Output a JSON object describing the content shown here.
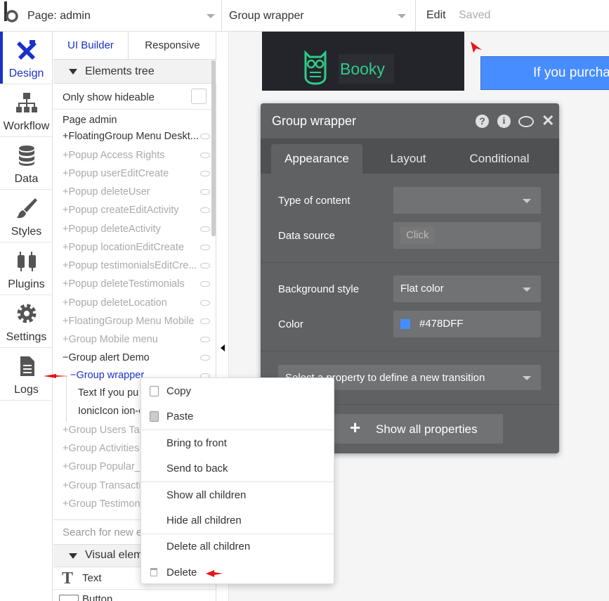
{
  "topbar": {
    "page_select": "Page: admin",
    "element_select": "Group wrapper",
    "edit_label": "Edit",
    "saved_label": "Saved"
  },
  "nav": {
    "items": [
      {
        "label": "Design",
        "icon": "design-icon"
      },
      {
        "label": "Workflow",
        "icon": "workflow-icon"
      },
      {
        "label": "Data",
        "icon": "database-icon"
      },
      {
        "label": "Styles",
        "icon": "brush-icon"
      },
      {
        "label": "Plugins",
        "icon": "plug-icon"
      },
      {
        "label": "Settings",
        "icon": "gear-icon"
      },
      {
        "label": "Logs",
        "icon": "document-icon"
      }
    ]
  },
  "panel": {
    "tabs": [
      "UI Builder",
      "Responsive"
    ],
    "elements_tree_label": "Elements tree",
    "only_hideable_label": "Only show hideable",
    "tree": [
      "Page admin",
      "FloatingGroup Menu Deskt...",
      "Popup Access Rights",
      "Popup userEditCreate",
      "Popup deleteUser",
      "Popup createEditActivity",
      "Popup deleteActivity",
      "Popup locationEditCreate",
      "Popup testimonialsEditCre...",
      "Popup deleteTestimonials",
      "Popup deleteLocation",
      "FloatingGroup Menu Mobile",
      "Group Mobile menu",
      "Group alert Demo",
      "Group wrapper",
      "Text If you pu",
      "IonicIcon ion-c",
      "Group Users Tab",
      "Group Activities T",
      "Group Popular_lo",
      "Group Transactio",
      "Group Testimonia"
    ],
    "search_placeholder": "Search for new e",
    "visual_elements_label": "Visual elem",
    "visual_items": [
      "Text",
      "Button"
    ]
  },
  "canvas": {
    "brand_name": "Booky",
    "alert_text": "If you purcha"
  },
  "editor": {
    "title": "Group wrapper",
    "tabs": [
      "Appearance",
      "Layout",
      "Conditional"
    ],
    "type_of_content_label": "Type of content",
    "data_source_label": "Data source",
    "data_source_placeholder": "Click",
    "background_style_label": "Background style",
    "background_style_value": "Flat color",
    "color_label": "Color",
    "color_value": "#478DFF",
    "transition_placeholder": "Select a property to define a new transition",
    "show_all_label": "Show all properties"
  },
  "context_menu": {
    "copy": "Copy",
    "paste": "Paste",
    "bring_to_front": "Bring to front",
    "send_to_back": "Send to back",
    "show_all_children": "Show all children",
    "hide_all_children": "Hide all children",
    "delete_all_children": "Delete all children",
    "delete": "Delete"
  },
  "colors": {
    "accent_blue": "#1a31c9",
    "swatch": "#478DFF",
    "annotation_red": "#e8141c",
    "brand_green": "#2ecc8b"
  }
}
